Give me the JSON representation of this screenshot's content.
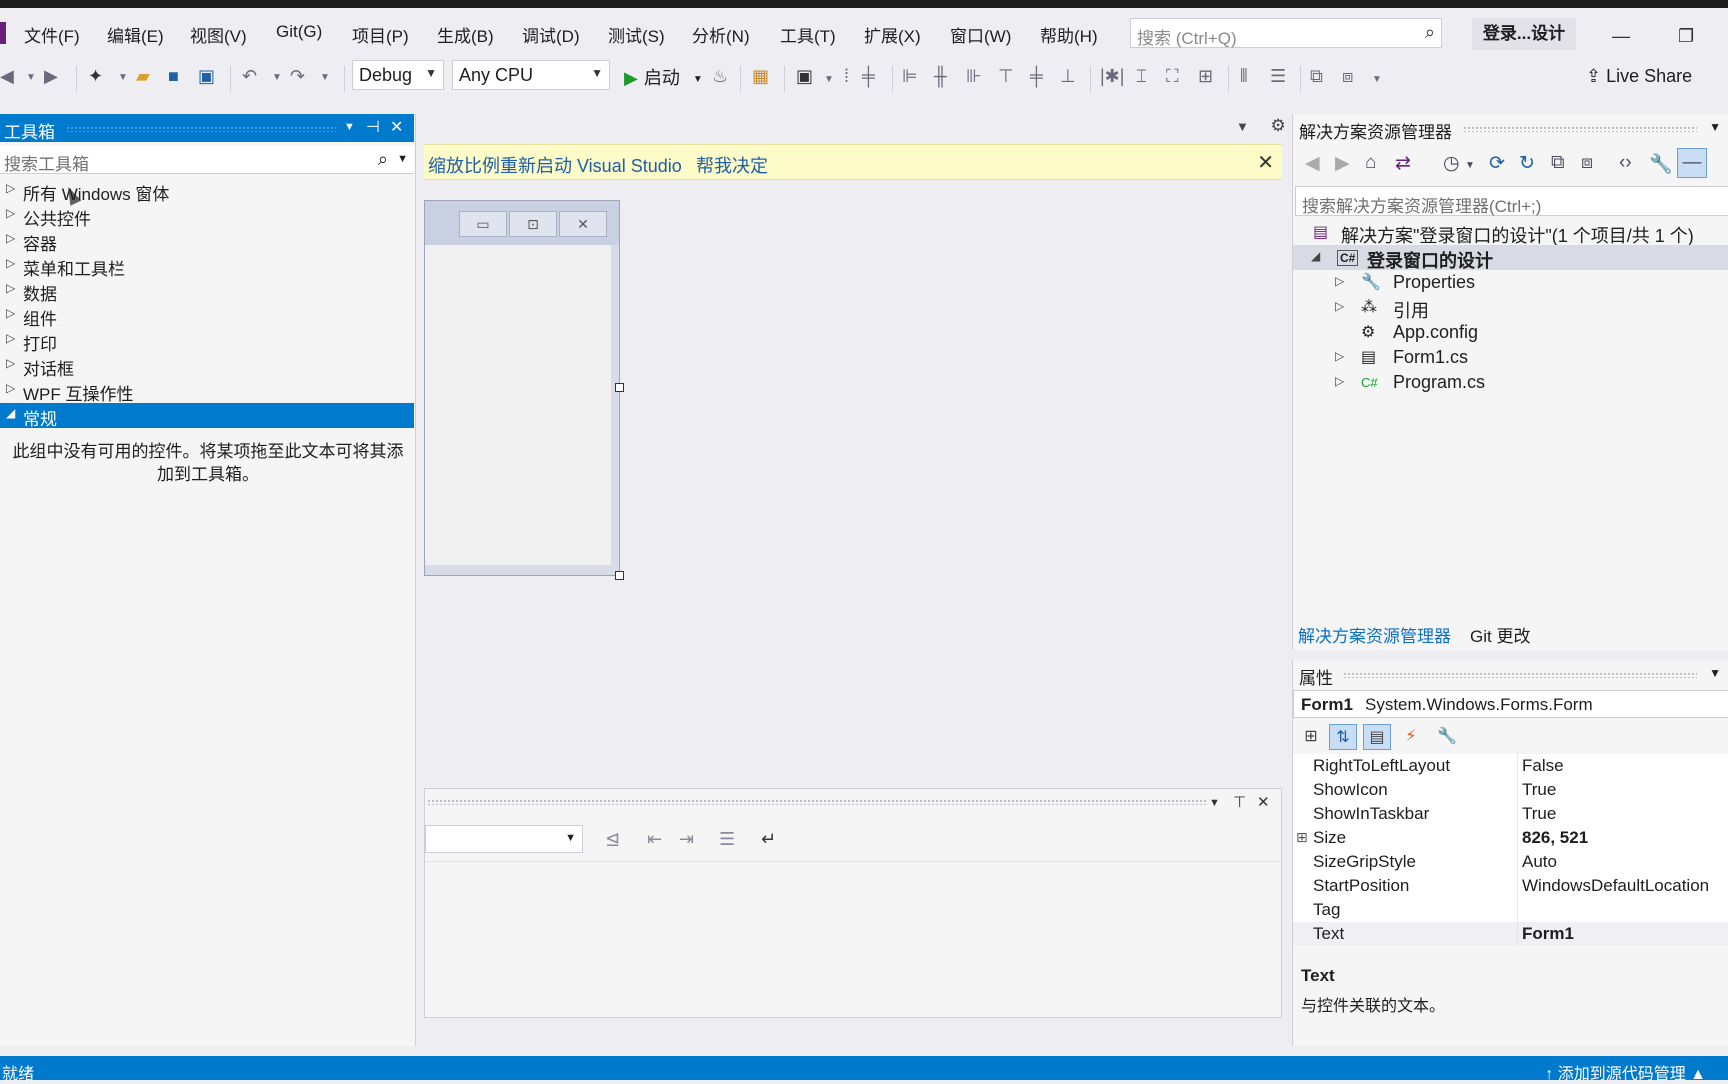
{
  "menu": {
    "items": [
      "文件(F)",
      "编辑(E)",
      "视图(V)",
      "Git(G)",
      "项目(P)",
      "生成(B)",
      "调试(D)",
      "测试(S)",
      "分析(N)",
      "工具(T)",
      "扩展(X)",
      "窗口(W)",
      "帮助(H)"
    ],
    "search_placeholder": "搜索 (Ctrl+Q)",
    "title": "登录...设计"
  },
  "toolbar": {
    "config": "Debug",
    "platform": "Any CPU",
    "start_label": "启动",
    "live_share_label": "Live Share"
  },
  "toolbox": {
    "title": "工具箱",
    "search_placeholder": "搜索工具箱",
    "categories": [
      {
        "label": "所有 Windows 窗体",
        "expanded": false
      },
      {
        "label": "公共控件",
        "expanded": false
      },
      {
        "label": "容器",
        "expanded": false
      },
      {
        "label": "菜单和工具栏",
        "expanded": false
      },
      {
        "label": "数据",
        "expanded": false
      },
      {
        "label": "组件",
        "expanded": false
      },
      {
        "label": "打印",
        "expanded": false
      },
      {
        "label": "对话框",
        "expanded": false
      },
      {
        "label": "WPF 互操作性",
        "expanded": false
      },
      {
        "label": "常规",
        "expanded": true
      }
    ],
    "empty_message": "此组中没有可用的控件。将某项拖至此文本可将其添加到工具箱。"
  },
  "infobar": {
    "message": "缩放比例重新启动 Visual Studio",
    "link": "帮我决定"
  },
  "solution_explorer": {
    "title": "解决方案资源管理器",
    "search_placeholder": "搜索解决方案资源管理器(Ctrl+;)",
    "tree": [
      {
        "label": "解决方案\"登录窗口的设计\"(1 个项目/共 1 个)",
        "icon": "solution-icon",
        "level": 0
      },
      {
        "label": "登录窗口的设计",
        "icon": "csharp-project-icon",
        "level": 1,
        "selected": true
      },
      {
        "label": "Properties",
        "icon": "wrench-icon",
        "level": 2
      },
      {
        "label": "引用",
        "icon": "references-icon",
        "level": 2
      },
      {
        "label": "App.config",
        "icon": "config-file-icon",
        "level": 2
      },
      {
        "label": "Form1.cs",
        "icon": "form-icon",
        "level": 2
      },
      {
        "label": "Program.cs",
        "icon": "csharp-file-icon",
        "level": 2
      }
    ],
    "tabs": [
      "解决方案资源管理器",
      "Git 更改"
    ]
  },
  "properties": {
    "title": "属性",
    "object_name": "Form1",
    "object_type": "System.Windows.Forms.Form",
    "rows": [
      {
        "name": "RightToLeftLayout",
        "value": "False"
      },
      {
        "name": "ShowIcon",
        "value": "True"
      },
      {
        "name": "ShowInTaskbar",
        "value": "True"
      },
      {
        "name": "Size",
        "value": "826, 521",
        "bold": true,
        "expandable": true
      },
      {
        "name": "SizeGripStyle",
        "value": "Auto"
      },
      {
        "name": "StartPosition",
        "value": "WindowsDefaultLocation"
      },
      {
        "name": "Tag",
        "value": ""
      },
      {
        "name": "Text",
        "value": "Form1",
        "bold": true
      }
    ],
    "desc_title": "Text",
    "desc_text": "与控件关联的文本。"
  },
  "status": {
    "left": "就绪",
    "right": "添加到源代码管理"
  }
}
